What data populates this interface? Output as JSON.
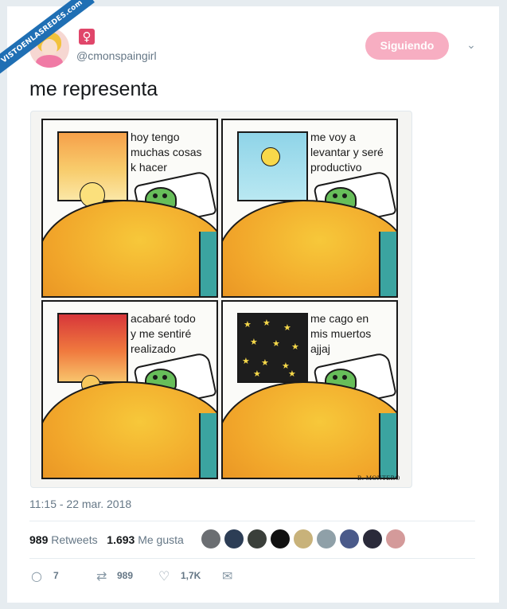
{
  "watermark": "VISTOENLASREDES.com",
  "account": {
    "gender_icon": "♀",
    "handle": "@cmonspaingirl",
    "follow_label": "Siguiendo"
  },
  "tweet": {
    "text": "me representa",
    "timestamp": "11:15 - 22 mar. 2018"
  },
  "comic": {
    "panels": [
      {
        "text": "hoy tengo\nmuchas cosas\nk hacer"
      },
      {
        "text": "me voy a\nlevantar y seré\nproductivo"
      },
      {
        "text": "acabaré todo\ny me sentiré\nrealizado"
      },
      {
        "text": "me cago en\nmis muertos\najjaj"
      }
    ],
    "signature": "B. MONTERO"
  },
  "stats": {
    "retweets_count": "989",
    "retweets_label": "Retweets",
    "likes_count": "1.693",
    "likes_label": "Me gusta"
  },
  "actions": {
    "reply_count": "7",
    "retweet_count": "989",
    "like_count": "1,7K"
  },
  "colors": {
    "follow_button": "#f7aec2",
    "ribbon": "#1f6fb4",
    "gender_badge": "#e0466a"
  }
}
